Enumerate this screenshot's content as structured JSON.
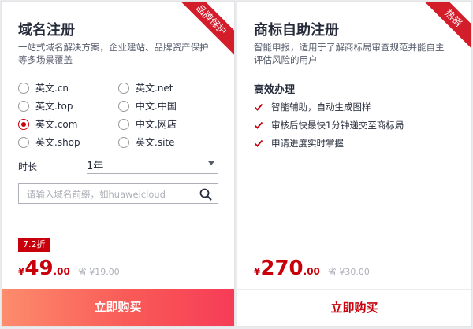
{
  "domain_card": {
    "ribbon": "品牌保护",
    "title": "域名注册",
    "desc": "一站式域名解决方案，企业建站、品牌资产保护等多场景覆盖",
    "suffixes": [
      {
        "label": "英文.cn",
        "checked": false
      },
      {
        "label": "英文.net",
        "checked": false
      },
      {
        "label": "英文.top",
        "checked": false
      },
      {
        "label": "中文.中国",
        "checked": false
      },
      {
        "label": "英文.com",
        "checked": true
      },
      {
        "label": "中文.网店",
        "checked": false
      },
      {
        "label": "英文.shop",
        "checked": false
      },
      {
        "label": "英文.site",
        "checked": false
      }
    ],
    "duration_label": "时长",
    "duration_value": "1年",
    "search_placeholder": "请输入域名前缀，如huaweicloud",
    "discount": "7.2折",
    "price_currency": "¥",
    "price_int": "49",
    "price_dec": ".00",
    "price_orig": "省 ¥19.00",
    "buy_label": "立即购买"
  },
  "tm_card": {
    "ribbon": "热销",
    "title": "商标自助注册",
    "desc": "智能申报，适用于了解商标局审查规范并能自主评估风险的用户",
    "sub_head": "高效办理",
    "features": [
      "智能辅助，自动生成图样",
      "审核后快最快1分钟递交至商标局",
      "申请进度实时掌握"
    ],
    "price_currency": "¥",
    "price_int": "270",
    "price_dec": ".00",
    "price_orig": "省 ¥30.00",
    "buy_label": "立即购买"
  },
  "colors": {
    "accent": "#c7000b",
    "ribbon": "#d31d2b",
    "buy_gradient_start": "#fd8c6d",
    "buy_gradient_end": "#f63c57"
  }
}
